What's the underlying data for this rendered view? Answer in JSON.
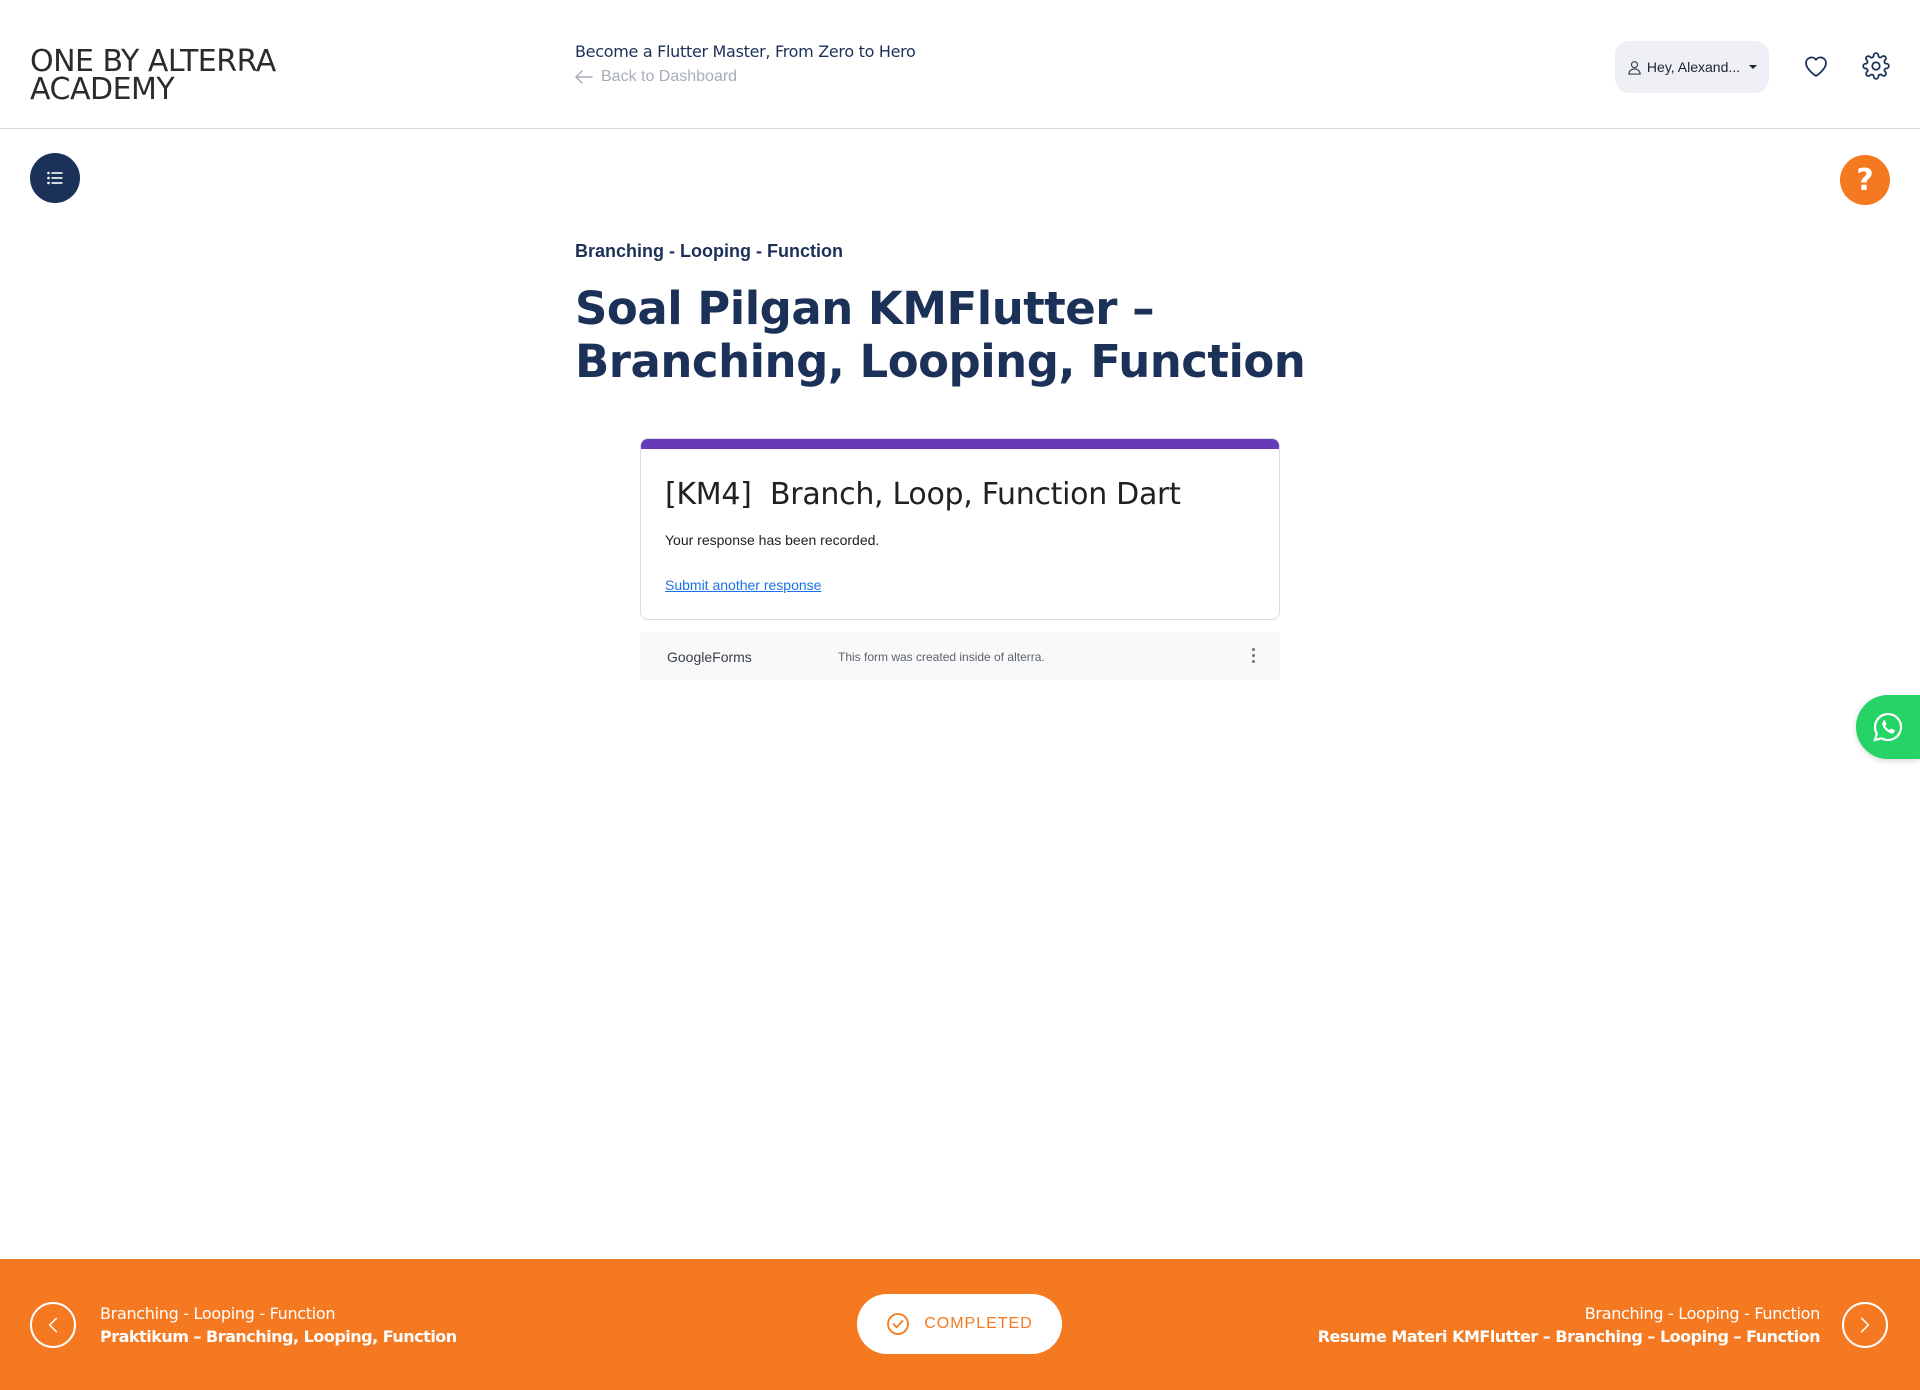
{
  "header": {
    "logo": "ONE BY ALTERRA ACADEMY",
    "course_title": "Become a Flutter Master, From Zero to Hero",
    "back_label": "Back to Dashboard",
    "user_label": "Hey, Alexand...",
    "favorites_icon": "heart-icon",
    "settings_icon": "gear-icon"
  },
  "floating": {
    "toc_icon": "list-icon",
    "help_label": "?",
    "whatsapp_icon": "whatsapp-icon"
  },
  "content": {
    "section": "Branching - Looping - Function",
    "title": "Soal Pilgan KMFlutter – Branching, Looping, Function"
  },
  "form": {
    "accent_color": "#673ab7",
    "title": "[KM4]  Branch, Loop, Function Dart",
    "message": "Your response has been recorded.",
    "submit_another": "Submit another response",
    "footer_logo": "GoogleForms",
    "footer_note": "This form was created inside of alterra."
  },
  "bottom": {
    "accent_color": "#f47921",
    "prev_section": "Branching - Looping - Function",
    "prev_title": "Praktikum – Branching, Looping, Function",
    "completed_label": "COMPLETED",
    "next_section": "Branching - Looping - Function",
    "next_title": "Resume Materi KMFlutter – Branching – Looping – Function"
  }
}
